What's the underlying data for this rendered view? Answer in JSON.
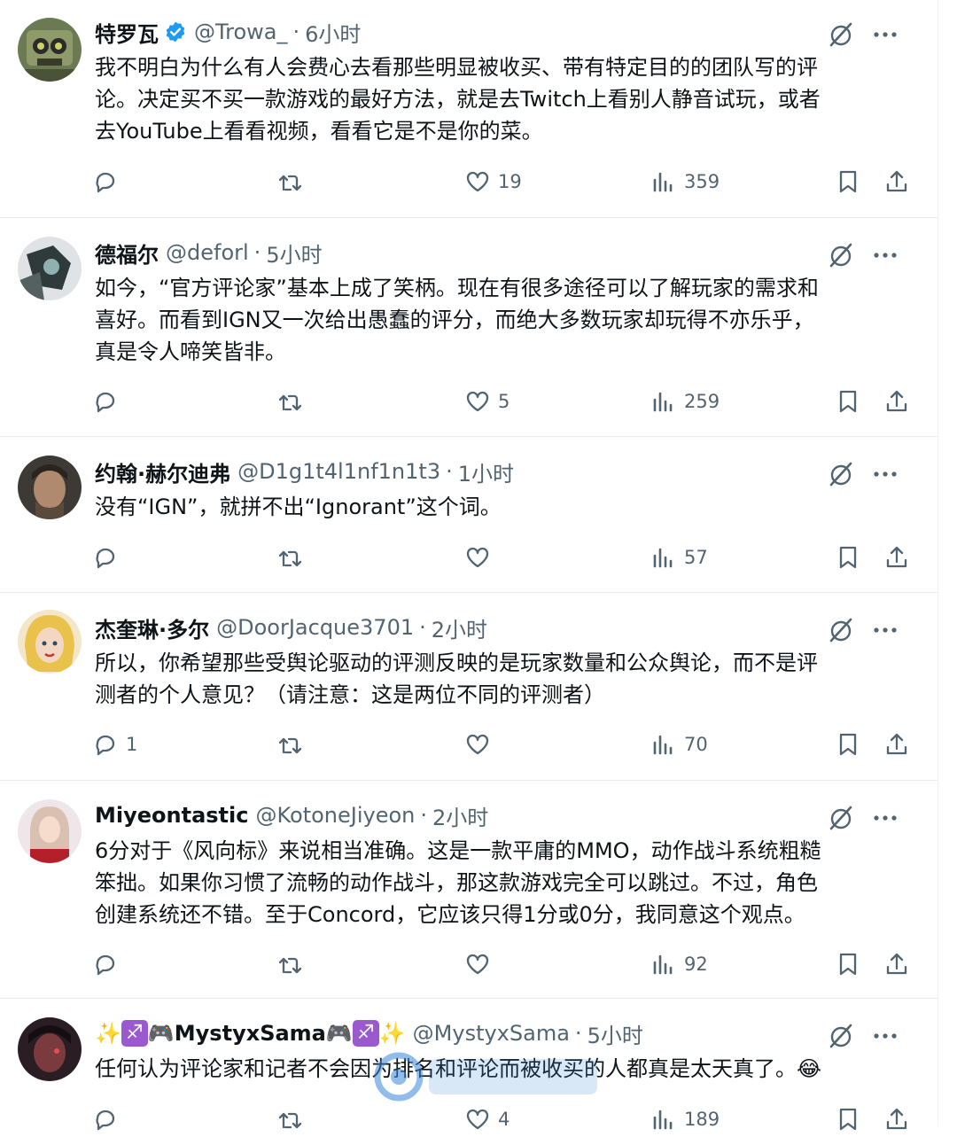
{
  "colors": {
    "text": "#0f1419",
    "muted": "#536471",
    "verified": "#1d9bf0",
    "divider": "#e6ecf0"
  },
  "tweets": [
    {
      "name": "特罗瓦",
      "verified": true,
      "handle": "@Trowa_",
      "time": "6小时",
      "text_lines": [
        "我不明白为什么有人会费心去看那些明显被收买、带有特定目的的团队写的评",
        "论。决定买不买一款游戏的最好方法，就是去Twitch上看别人静音试玩，或者",
        "去YouTube上看看视频，看看它是不是你的菜。"
      ],
      "replies": "",
      "reposts": "",
      "likes": "19",
      "views": "359"
    },
    {
      "name": "德福尔",
      "handle": "@deforl",
      "time": "5小时",
      "text_lines": [
        "如今，“官方评论家”基本上成了笑柄。现在有很多途径可以了解玩家的需求和",
        "喜好。而看到IGN又一次给出愚蠢的评分，而绝大多数玩家却玩得不亦乐乎，",
        "真是令人啼笑皆非。"
      ],
      "replies": "",
      "reposts": "",
      "likes": "5",
      "views": "259"
    },
    {
      "name": "约翰·赫尔迪弗",
      "handle": "@D1g1t4l1nf1n1t3",
      "time": "1小时",
      "text_lines": [
        "没有“IGN”，就拼不出“Ignorant”这个词。"
      ],
      "replies": "",
      "reposts": "",
      "likes": "",
      "views": "57"
    },
    {
      "name": "杰奎琳·多尔",
      "handle": "@DoorJacque3701",
      "time": "2小时",
      "text_lines": [
        "所以，你希望那些受舆论驱动的评测反映的是玩家数量和公众舆论，而不是评",
        "测者的个人意见？（请注意：这是两位不同的评测者）"
      ],
      "replies": "1",
      "reposts": "",
      "likes": "",
      "views": "70"
    },
    {
      "name": "Miyeontastic",
      "handle": "@KotoneJiyeon",
      "time": "2小时",
      "text_lines": [
        "6分对于《风向标》来说相当准确。这是一款平庸的MMO，动作战斗系统粗糙",
        "笨拙。如果你习惯了流畅的动作战斗，那这款游戏完全可以跳过。不过，角色",
        "创建系统还不错。至于Concord，它应该只得1分或0分，我同意这个观点。"
      ],
      "replies": "",
      "reposts": "",
      "likes": "",
      "views": "92"
    },
    {
      "name": "MystyxSama",
      "name_prefix": "✨♐🎮",
      "name_suffix": "🎮♐✨",
      "handle": "@MystyxSama",
      "time": "5小时",
      "text_lines": [
        "任何认为评论家和记者不会因为排名和评论而被收买的人都真是太天真了。😂"
      ],
      "replies": "",
      "reposts": "",
      "likes": "4",
      "views": "189"
    }
  ],
  "separator": "·",
  "watermark_icon": "watermark-logo"
}
